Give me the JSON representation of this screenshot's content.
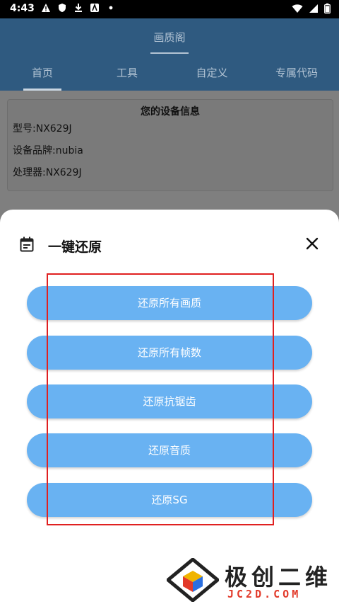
{
  "status_bar": {
    "time": "4:43",
    "left_icons": [
      "alert-icon",
      "shield-icon",
      "download-icon",
      "a-badge-icon",
      "dot-icon"
    ],
    "right_icons": [
      "wifi-icon",
      "signal-icon",
      "battery-icon"
    ]
  },
  "app": {
    "title": "画质阁",
    "tabs": [
      "首页",
      "工具",
      "自定义",
      "专属代码"
    ],
    "active_tab": "首页"
  },
  "device_info": {
    "title": "您的设备信息",
    "model": "型号:NX629J",
    "brand": "设备品牌:nubia",
    "processor": "处理器:NX629J"
  },
  "sheet": {
    "title": "一键还原",
    "buttons": [
      "还原所有画质",
      "还原所有帧数",
      "还原抗锯齿",
      "还原音质",
      "还原SG"
    ]
  },
  "watermark": {
    "text": "极创二维",
    "sub": "JC2D.COM"
  },
  "colors": {
    "button": "#69b2f2",
    "appbar_dimmed": "#2f5a80",
    "highlight": "#e02020"
  }
}
